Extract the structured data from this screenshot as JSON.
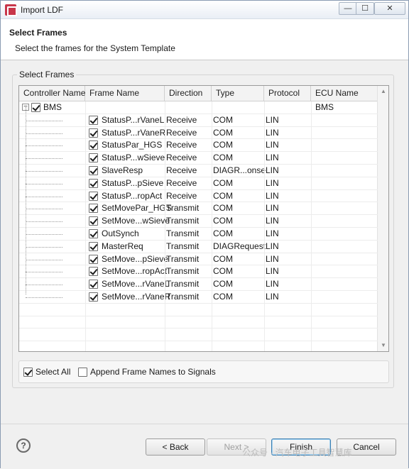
{
  "window": {
    "title": "Import LDF"
  },
  "header": {
    "title": "Select Frames",
    "subtitle": "Select the frames for the System Template"
  },
  "group": {
    "label": "Select Frames"
  },
  "table": {
    "columns": [
      "Controller Name",
      "Frame Name",
      "Direction",
      "Type",
      "Protocol",
      "ECU Name"
    ],
    "root": {
      "controller": "BMS",
      "ecu": "BMS",
      "checked": true,
      "expander": "−"
    },
    "rows": [
      {
        "frame": "StatusP...rVaneL",
        "direction": "Receive",
        "type": "COM",
        "protocol": "LIN",
        "checked": true
      },
      {
        "frame": "StatusP...rVaneR",
        "direction": "Receive",
        "type": "COM",
        "protocol": "LIN",
        "checked": true
      },
      {
        "frame": "StatusPar_HGS",
        "direction": "Receive",
        "type": "COM",
        "protocol": "LIN",
        "checked": true
      },
      {
        "frame": "StatusP...wSieve",
        "direction": "Receive",
        "type": "COM",
        "protocol": "LIN",
        "checked": true
      },
      {
        "frame": "SlaveResp",
        "direction": "Receive",
        "type": "DIAGR...onse",
        "protocol": "LIN",
        "checked": true
      },
      {
        "frame": "StatusP...pSieve",
        "direction": "Receive",
        "type": "COM",
        "protocol": "LIN",
        "checked": true
      },
      {
        "frame": "StatusP...ropAct",
        "direction": "Receive",
        "type": "COM",
        "protocol": "LIN",
        "checked": true
      },
      {
        "frame": "SetMovePar_HGS",
        "direction": "Transmit",
        "type": "COM",
        "protocol": "LIN",
        "checked": true
      },
      {
        "frame": "SetMove...wSieve",
        "direction": "Transmit",
        "type": "COM",
        "protocol": "LIN",
        "checked": true
      },
      {
        "frame": "OutSynch",
        "direction": "Transmit",
        "type": "COM",
        "protocol": "LIN",
        "checked": true
      },
      {
        "frame": "MasterReq",
        "direction": "Transmit",
        "type": "DIAGRequest",
        "protocol": "LIN",
        "checked": true
      },
      {
        "frame": "SetMove...pSieve",
        "direction": "Transmit",
        "type": "COM",
        "protocol": "LIN",
        "checked": true
      },
      {
        "frame": "SetMove...ropAct",
        "direction": "Transmit",
        "type": "COM",
        "protocol": "LIN",
        "checked": true
      },
      {
        "frame": "SetMove...rVaneL",
        "direction": "Transmit",
        "type": "COM",
        "protocol": "LIN",
        "checked": true
      },
      {
        "frame": "SetMove...rVaneR",
        "direction": "Transmit",
        "type": "COM",
        "protocol": "LIN",
        "checked": true
      }
    ]
  },
  "options": {
    "select_all": "Select All",
    "select_all_checked": true,
    "append_names": "Append Frame Names to Signals",
    "append_names_checked": false
  },
  "footer": {
    "help": "?",
    "back": "< Back",
    "next": "Next >",
    "finish": "Finish",
    "cancel": "Cancel",
    "watermark": "公众号 · 汽车电子工具智慧库"
  },
  "titlebar_buttons": {
    "minimize": "—",
    "maximize": "☐",
    "close": "✕"
  },
  "colors": {
    "app_icon": "#c8364a",
    "default_button_border": "#3c7fb1"
  }
}
